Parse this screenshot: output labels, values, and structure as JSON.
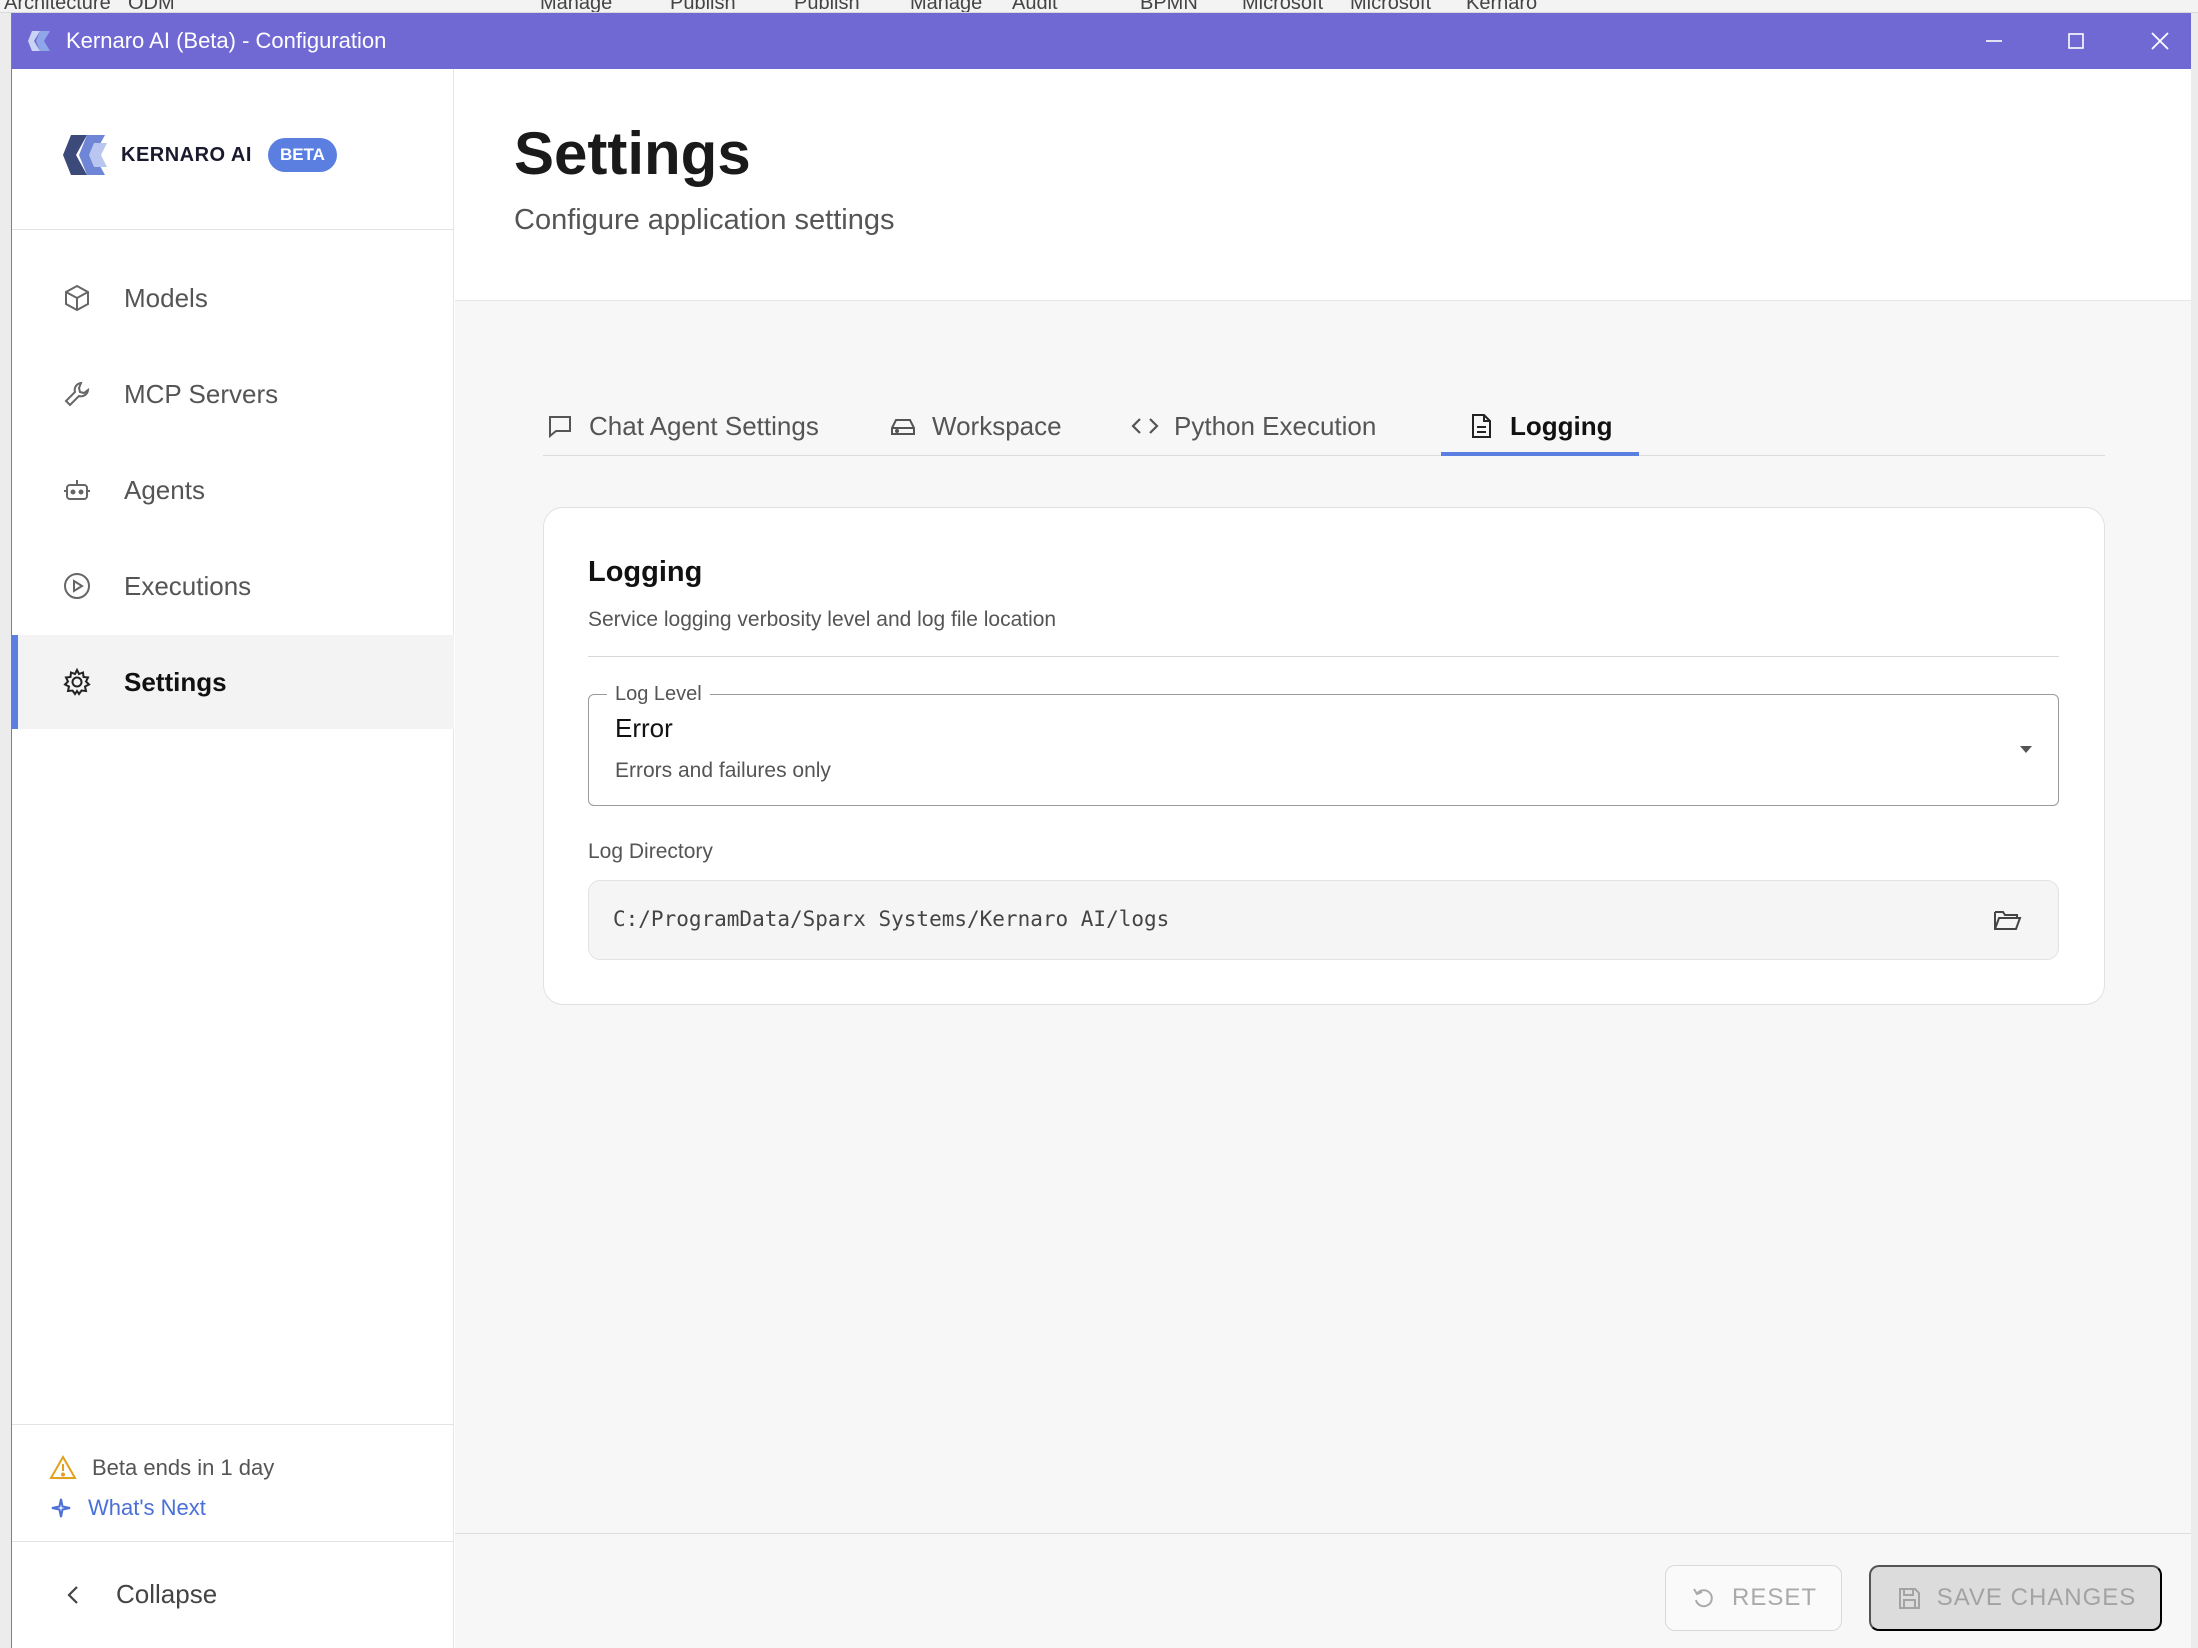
{
  "window": {
    "title": "Kernaro AI (Beta) - Configuration"
  },
  "background_app": {
    "tabs": [
      "Architecture",
      "ODM",
      "Manage",
      "Publish",
      "Publish",
      "Manage",
      "Audit",
      "BPMN",
      "Microsoft",
      "Microsoft",
      "Kernaro"
    ]
  },
  "brand": {
    "name": "KERNARO AI",
    "badge": "BETA",
    "accent_color": "#5b7fe0",
    "titlebar_color": "#7169d3"
  },
  "sidebar": {
    "items": [
      {
        "label": "Models",
        "icon": "cube-icon",
        "active": false
      },
      {
        "label": "MCP Servers",
        "icon": "wrench-icon",
        "active": false
      },
      {
        "label": "Agents",
        "icon": "robot-icon",
        "active": false
      },
      {
        "label": "Executions",
        "icon": "play-circle-icon",
        "active": false
      },
      {
        "label": "Settings",
        "icon": "gear-icon",
        "active": true
      }
    ],
    "beta_notice": "Beta ends in 1 day",
    "whats_next": "What's Next",
    "collapse": "Collapse"
  },
  "header": {
    "title": "Settings",
    "subtitle": "Configure application settings"
  },
  "tabs": [
    {
      "label": "Chat Agent Settings",
      "icon": "chat-icon",
      "active": false
    },
    {
      "label": "Workspace",
      "icon": "drive-icon",
      "active": false
    },
    {
      "label": "Python Execution",
      "icon": "code-icon",
      "active": false
    },
    {
      "label": "Logging",
      "icon": "document-icon",
      "active": true
    }
  ],
  "logging": {
    "title": "Logging",
    "description": "Service logging verbosity level and log file location",
    "log_level": {
      "label": "Log Level",
      "value": "Error",
      "hint": "Errors and failures only"
    },
    "log_directory": {
      "label": "Log Directory",
      "value": "C:/ProgramData/Sparx Systems/Kernaro AI/logs"
    }
  },
  "footer": {
    "reset": "RESET",
    "save": "SAVE CHANGES"
  }
}
